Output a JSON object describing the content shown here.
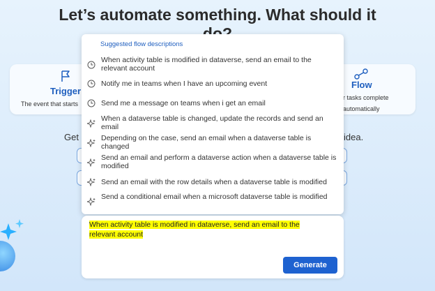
{
  "heading": {
    "line1": "Let’s automate something. What should it",
    "line2": "do?"
  },
  "trigger_card": {
    "icon": "flag-icon",
    "title": "Trigger",
    "desc": "The event that starts"
  },
  "flow_card": {
    "icon": "flow-icon",
    "title": "Flow",
    "desc1": "r tasks complete",
    "desc2": "automatically"
  },
  "background": {
    "left_text": "Get s",
    "right_text": "idea."
  },
  "suggestions": {
    "header": "Suggested flow descriptions",
    "items": [
      {
        "icon": "clock-icon",
        "text": "When activity table is modified in dataverse, send an email to the relevant account"
      },
      {
        "icon": "clock-icon",
        "text": "Notify me in teams when I have an upcoming event"
      },
      {
        "icon": "clock-icon",
        "text": "Send me a message on teams when i get an email"
      },
      {
        "icon": "sparkle-icon",
        "text": "When a dataverse table is changed, update the records and send an email"
      },
      {
        "icon": "sparkle-icon",
        "text": "Depending on the case, send an email when a dataverse table is changed"
      },
      {
        "icon": "sparkle-icon",
        "text": "Send an email and perform a dataverse action when a dataverse table is modified"
      },
      {
        "icon": "sparkle-icon",
        "text": "Send an email with the row details when a dataverse table is modified"
      },
      {
        "icon": "sparkle-icon",
        "text": "Send a conditional email when a microsoft dataverse table is modified"
      }
    ]
  },
  "prompt": {
    "line1": "When activity table is modified in dataverse, send an email to the",
    "line2": "relevant account",
    "generate_label": "Generate"
  }
}
